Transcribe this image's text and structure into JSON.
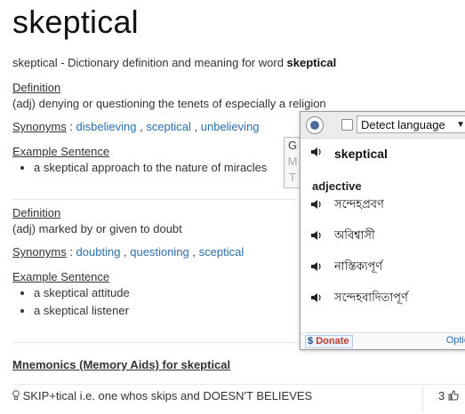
{
  "page": {
    "title": "skeptical",
    "subtitle_prefix": "skeptical - Dictionary definition and meaning for word ",
    "subtitle_word": "skeptical"
  },
  "sense1": {
    "definition_label": "Definition",
    "definition_text": "(adj) denying or questioning the tenets of especially a religion",
    "synonyms_label": "Synonyms",
    "synonyms": [
      "disbelieving",
      "sceptical",
      "unbelieving"
    ],
    "example_label": "Example Sentence",
    "examples": [
      "a skeptical approach to the nature of miracles"
    ]
  },
  "sense2": {
    "definition_label": "Definition",
    "definition_text": "(adj) marked by or given to doubt",
    "synonyms_label": "Synonyms",
    "synonyms": [
      "doubting",
      "questioning",
      "sceptical"
    ],
    "example_label": "Example Sentence",
    "examples": [
      "a skeptical attitude",
      "a skeptical listener"
    ]
  },
  "mnemonics": {
    "title": "Mnemonics (Memory Aids) for skeptical",
    "text": "SKIP+tical i.e. one whos skips and DOESN'T BELIEVES",
    "votes": "3"
  },
  "side_tab": {
    "g": "G",
    "m": "M",
    "t": "T"
  },
  "translator": {
    "language": "Detect language",
    "word": "skeptical",
    "part_of_speech": "adjective",
    "translations": [
      "সন্দেহপ্রবণ",
      "অবিশ্বাসী",
      "নাস্তিক্যপূর্ণ",
      "সন্দেহবাদিতাপূর্ণ"
    ],
    "donate_label": "Donate",
    "options_label": "Optio"
  },
  "icons": {
    "speaker": "speaker-icon",
    "eye": "eye-icon",
    "bulb": "lightbulb-icon",
    "thumb": "thumbs-up-icon"
  }
}
